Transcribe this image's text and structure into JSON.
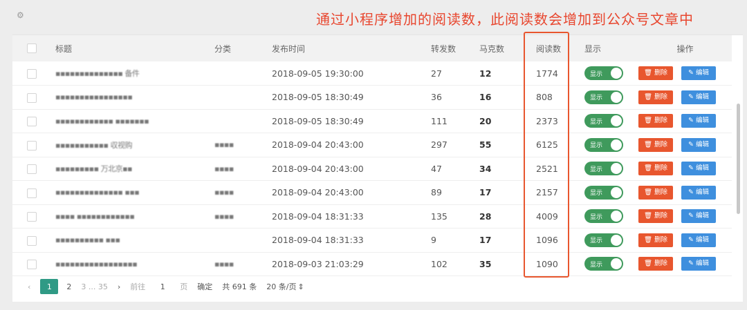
{
  "annotation": "通过小程序增加的阅读数，此阅读数会增加到公众号文章中",
  "table": {
    "headers": {
      "title": "标题",
      "category": "分类",
      "publish_time": "发布时间",
      "forwards": "转发数",
      "likes": "马克数",
      "reads": "阅读数",
      "show": "显示",
      "actions": "操作"
    },
    "toggle_label": "显示",
    "delete_label": "删除",
    "edit_label": "编辑",
    "rows": [
      {
        "title": "▪▪▪▪▪▪▪▪▪▪▪▪▪▪ 备件",
        "category": "",
        "time": "2018-09-05 19:30:00",
        "forwards": "27",
        "likes": "12",
        "reads": "1774"
      },
      {
        "title": "▪▪▪▪▪▪▪▪▪▪▪▪▪▪▪▪",
        "category": "",
        "time": "2018-09-05 18:30:49",
        "forwards": "36",
        "likes": "16",
        "reads": "808"
      },
      {
        "title": "▪▪▪▪▪▪▪▪▪▪▪▪ ▪▪▪▪▪▪▪",
        "category": "",
        "time": "2018-09-05 18:30:49",
        "forwards": "111",
        "likes": "20",
        "reads": "2373"
      },
      {
        "title": "▪▪▪▪▪▪▪▪▪▪▪ 収视购",
        "category": "▪▪▪▪",
        "time": "2018-09-04 20:43:00",
        "forwards": "297",
        "likes": "55",
        "reads": "6125"
      },
      {
        "title": "▪▪▪▪▪▪▪▪▪ 万北京▪▪",
        "category": "▪▪▪▪",
        "time": "2018-09-04 20:43:00",
        "forwards": "47",
        "likes": "34",
        "reads": "2521"
      },
      {
        "title": "▪▪▪▪▪▪▪▪▪▪▪▪▪▪ ▪▪▪",
        "category": "▪▪▪▪",
        "time": "2018-09-04 20:43:00",
        "forwards": "89",
        "likes": "17",
        "reads": "2157"
      },
      {
        "title": "▪▪▪▪ ▪▪▪▪▪▪▪▪▪▪▪▪",
        "category": "▪▪▪▪",
        "time": "2018-09-04 18:31:33",
        "forwards": "135",
        "likes": "28",
        "reads": "4009"
      },
      {
        "title": "▪▪▪▪▪▪▪▪▪▪ ▪▪▪",
        "category": "",
        "time": "2018-09-04 18:31:33",
        "forwards": "9",
        "likes": "17",
        "reads": "1096"
      },
      {
        "title": "▪▪▪▪▪▪▪▪▪▪▪▪▪▪▪▪▪",
        "category": "▪▪▪▪",
        "time": "2018-09-03 21:03:29",
        "forwards": "102",
        "likes": "35",
        "reads": "1090"
      }
    ]
  },
  "pager": {
    "current_page": "1",
    "next_page": "2",
    "pages_faint": "3 ... 35",
    "goto_label": "前往",
    "goto_value": "1",
    "page_unit": "页",
    "confirm": "确定",
    "total": "共 691 条",
    "page_size": "20 条/页"
  },
  "icons": {
    "gear": "gear-icon",
    "prev": "chevron-left-icon",
    "next": "chevron-right-icon",
    "edit": "pencil-icon",
    "delete": "trash-icon",
    "sort": "sort-arrows-icon"
  },
  "colors": {
    "annotation": "#e8462e",
    "toggle_on": "#3f9a5c",
    "delete": "#e8562e",
    "edit": "#3e8fde",
    "pager_active": "#2f9a85"
  }
}
